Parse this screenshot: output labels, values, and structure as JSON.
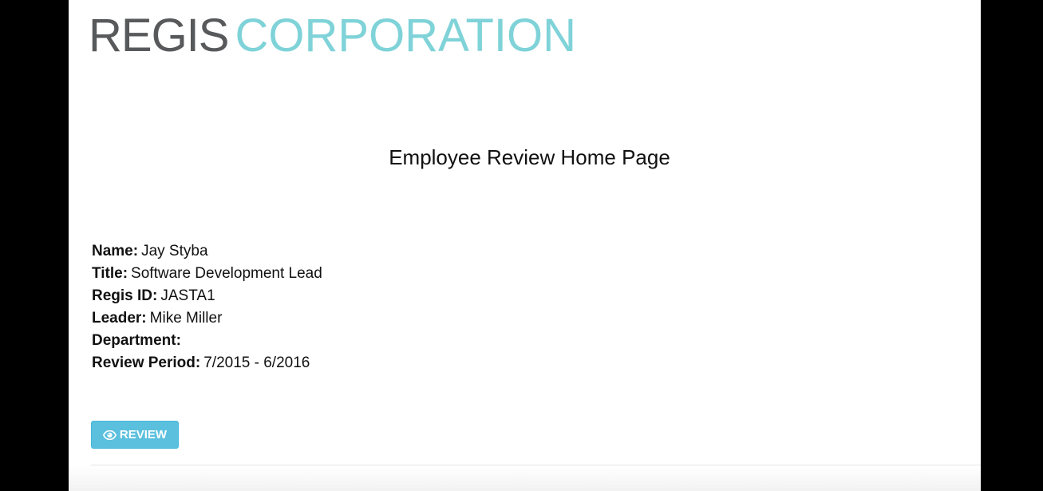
{
  "logo": {
    "regis": "REGIS",
    "corporation": "CORPORATION",
    "colors": {
      "regis": "#58595b",
      "corporation": "#7fd3d8"
    }
  },
  "page": {
    "heading": "Employee Review Home Page"
  },
  "employee": {
    "name_label": "Name:",
    "name": "Jay Styba",
    "title_label": "Title:",
    "title": "Software Development Lead",
    "regis_id_label": "Regis ID:",
    "regis_id": "JASTA1",
    "leader_label": "Leader:",
    "leader": "Mike Miller",
    "department_label": "Department:",
    "department": "",
    "review_period_label": "Review Period:",
    "review_period": "7/2015 - 6/2016"
  },
  "actions": {
    "review_label": "REVIEW",
    "review_icon": "eye-icon",
    "review_color": "#5bc0de"
  }
}
